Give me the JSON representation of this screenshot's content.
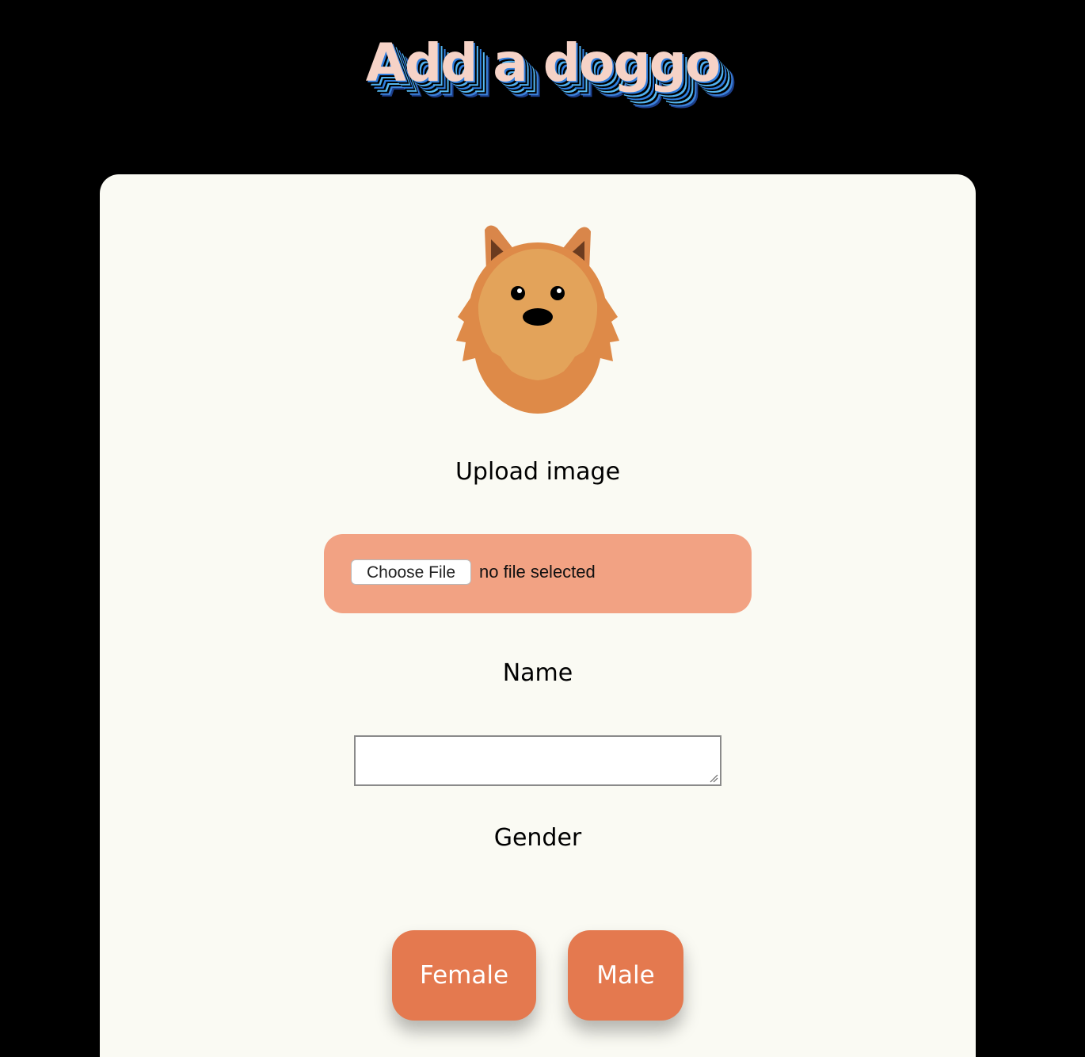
{
  "header": {
    "title": "Add a doggo"
  },
  "form": {
    "upload_label": "Upload image",
    "file_button_label": "Choose File",
    "file_status": "no file selected",
    "name_label": "Name",
    "name_value": "",
    "gender_label": "Gender",
    "gender_options": [
      "Female",
      "Male"
    ]
  },
  "colors": {
    "background": "#000000",
    "card": "#fafaf3",
    "file_box": "#f2a283",
    "button": "#e4794f",
    "title_fill": "#f6d3c7",
    "title_shadow": "#4fb0f0"
  },
  "icons": {
    "dog": "pomeranian-face-icon"
  }
}
